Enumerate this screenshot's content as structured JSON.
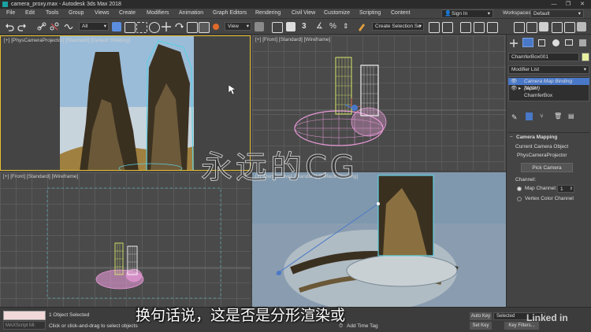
{
  "window": {
    "title": "camera_proxy.max - Autodesk 3ds Max 2018",
    "controls": [
      "—",
      "❐",
      "✕"
    ]
  },
  "menu": {
    "items": [
      "File",
      "Edit",
      "Tools",
      "Group",
      "Views",
      "Create",
      "Modifiers",
      "Animation",
      "Graph Editors",
      "Rendering",
      "Civil View",
      "Customize",
      "Scripting",
      "Content"
    ],
    "sign_in": "Sign In",
    "workspaces_label": "Workspaces:",
    "workspaces_value": "Default"
  },
  "toolbar": {
    "filter_value": "All",
    "view_value": "View",
    "selection_set_placeholder": "Create Selection Se"
  },
  "viewports": {
    "top_left": {
      "label": "[+] [PhysCameraProjector] [Standard] [Default Shading]"
    },
    "top_right": {
      "label": "[+] [Front] [Standard] [Wireframe]"
    },
    "bottom_left": {
      "label": "[+] [Front] [Standard] [Wireframe]"
    },
    "bottom_right": {
      "label": "[+] [Perspective] [Standard] [Default Shading]"
    }
  },
  "command_panel": {
    "object_name": "ChamferBox001",
    "object_color": "#e8f0a0",
    "modifier_list_label": "Modifier List",
    "stack": [
      {
        "label": "Camera Map Binding (WSM)",
        "selected": true
      },
      {
        "label": "Taper",
        "selected": false
      },
      {
        "label": "ChamferBox",
        "selected": false
      }
    ],
    "rollout_title": "Camera Mapping",
    "camera_object_label": "Current Camera Object",
    "camera_object_value": "PhysCameraProjector",
    "pick_camera_label": "Pick Camera",
    "channel_label": "Channel:",
    "map_channel_label": "Map Channel:",
    "map_channel_value": "1",
    "vertex_color_label": "Vertex Color Channel"
  },
  "status": {
    "maxscript_placeholder": "MAXScript Mi:",
    "selected_text": "1 Object Selected",
    "prompt_text": "Click or click-and-drag to select objects",
    "add_time_tag": "Add Time Tag",
    "auto_key": "Auto Key",
    "set_key": "Set Key",
    "selected_dropdown": "Selected",
    "key_filters": "Key Filters..."
  },
  "overlay": {
    "subtitle": "换句话说，这是否是分形渲染或",
    "watermark": "永远的CG",
    "brand": "Linked in"
  },
  "colors": {
    "accent_blue": "#4a78c8",
    "selection_cyan": "#5ecfe0",
    "wire_pink": "#e89ad8",
    "wire_yellow": "#d8e86a"
  }
}
